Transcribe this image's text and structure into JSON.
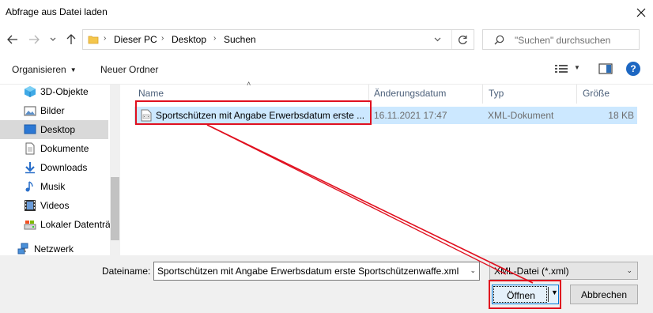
{
  "window": {
    "title": "Abfrage aus Datei laden"
  },
  "nav": {
    "breadcrumbs": [
      "Dieser PC",
      "Desktop",
      "Suchen"
    ],
    "search_placeholder": "\"Suchen\" durchsuchen"
  },
  "toolbar": {
    "organize": "Organisieren",
    "new_folder": "Neuer Ordner"
  },
  "sidebar": {
    "items": [
      {
        "label": "3D-Objekte",
        "icon": "3d-objects-icon"
      },
      {
        "label": "Bilder",
        "icon": "pictures-icon"
      },
      {
        "label": "Desktop",
        "icon": "desktop-icon",
        "selected": true
      },
      {
        "label": "Dokumente",
        "icon": "documents-icon"
      },
      {
        "label": "Downloads",
        "icon": "downloads-icon"
      },
      {
        "label": "Musik",
        "icon": "music-icon"
      },
      {
        "label": "Videos",
        "icon": "videos-icon"
      },
      {
        "label": "Lokaler Datenträ",
        "icon": "drive-icon"
      },
      {
        "label": "Netzwerk",
        "icon": "network-icon"
      }
    ]
  },
  "filelist": {
    "columns": [
      "Name",
      "Änderungsdatum",
      "Typ",
      "Größe"
    ],
    "rows": [
      {
        "name": "Sportschützen mit Angabe Erwerbsdatum erste ...",
        "date": "16.11.2021 17:47",
        "type": "XML-Dokument",
        "size": "18 KB"
      }
    ]
  },
  "bottom": {
    "filename_label": "Dateiname:",
    "filename_value": "Sportschützen mit Angabe Erwerbsdatum erste Sportschützenwaffe.xml",
    "filetype_value": "XML-Datei (*.xml)",
    "open_label": "Öffnen",
    "cancel_label": "Abbrechen"
  },
  "colors": {
    "annotation": "#e0101f",
    "selection": "#cce8ff",
    "accent": "#0078d7"
  }
}
